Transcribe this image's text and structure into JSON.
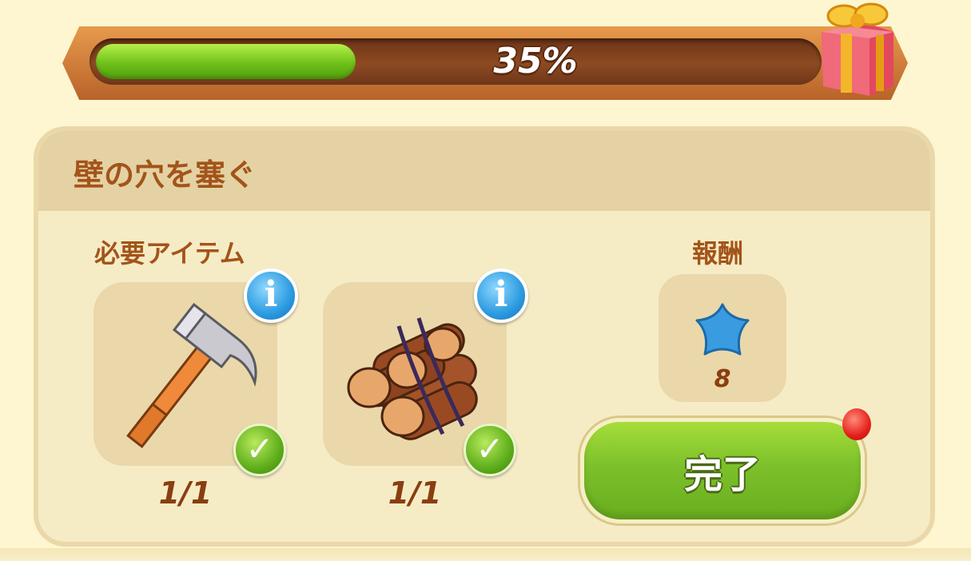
{
  "progress": {
    "percent": 0.35,
    "label": "35%"
  },
  "gift": {
    "icon": "gift-box-icon"
  },
  "task": {
    "title": "壁の穴を塞ぐ",
    "required_label": "必要アイテム",
    "reward_label": "報酬",
    "items": [
      {
        "icon": "hammer-icon",
        "count": "1/1",
        "complete": true
      },
      {
        "icon": "wood-logs-icon",
        "count": "1/1",
        "complete": true
      }
    ],
    "reward": {
      "icon": "blue-star-icon",
      "count": "8"
    },
    "complete_button_label": "完了"
  },
  "colors": {
    "accent_text": "#a3541a",
    "progress_fill": "#6fc11a",
    "button_green": "#7cc12b",
    "info_blue": "#2c9be0",
    "notification_red": "#e4211a"
  }
}
